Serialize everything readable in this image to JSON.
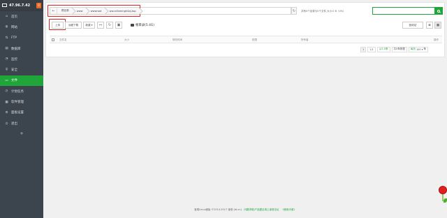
{
  "server": {
    "ip": "47.96.7.42",
    "badge": "0"
  },
  "sidebar": {
    "items": [
      {
        "label": "首页",
        "icon": "⌂",
        "icon_name": "home-icon",
        "active": false
      },
      {
        "label": "网站",
        "icon": "◍",
        "icon_name": "globe-icon",
        "active": false
      },
      {
        "label": "FTP",
        "icon": "⇅",
        "icon_name": "ftp-icon",
        "active": false
      },
      {
        "label": "数据库",
        "icon": "▤",
        "icon_name": "database-icon",
        "active": false
      },
      {
        "label": "监控",
        "icon": "◔",
        "icon_name": "monitor-icon",
        "active": false
      },
      {
        "label": "安全",
        "icon": "⛨",
        "icon_name": "shield-icon",
        "active": false
      },
      {
        "label": "文件",
        "icon": "▭",
        "icon_name": "folder-icon",
        "active": true
      },
      {
        "label": "计划任务",
        "icon": "◷",
        "icon_name": "clock-icon",
        "active": false
      },
      {
        "label": "软件管理",
        "icon": "▦",
        "icon_name": "grid-icon",
        "active": false
      },
      {
        "label": "面板设置",
        "icon": "⚙",
        "icon_name": "gear-icon",
        "active": false
      },
      {
        "label": "退出",
        "icon": "⏻",
        "icon_name": "logout-icon",
        "active": false
      }
    ],
    "add": "+"
  },
  "path": {
    "back": "←",
    "crumbs": [
      "根目录",
      "www",
      "wwwroot",
      "ww.cdlnmingh4aj.top"
    ],
    "refresh": "↻"
  },
  "dir_info": "共有0个目录与0个文件,大小:0 B（0%）",
  "toolbar": {
    "upload": "上传",
    "remote_download": "远程下载",
    "new": "新建 ▾",
    "back_icon": "↤",
    "refresh_icon": "↻",
    "terminal_icon": "▣",
    "disk": "根目录(5.4G)",
    "recycle": "回收站",
    "list_view": "≣",
    "grid_view": "▦"
  },
  "table": {
    "headers": [
      "文件名",
      "大小",
      "修改时间",
      "权限",
      "所有者",
      "操作"
    ]
  },
  "pager": {
    "page": "1",
    "total": "1/1",
    "from_to": "从1-0条",
    "count": "共0条数据",
    "per_page_label": "每页",
    "per_page_value": "100",
    "unit": "条"
  },
  "footer": {
    "copyright": "宝塔Linux面板 ©2014-2017 宝塔 (bt.cn)",
    "forum": "问题求助|产品建议请上宝塔论坛",
    "manual": "《使用手册》"
  },
  "colors": {
    "accent": "#20a53a",
    "sidebar": "#3c444d",
    "highlight_box": "#e02020"
  }
}
